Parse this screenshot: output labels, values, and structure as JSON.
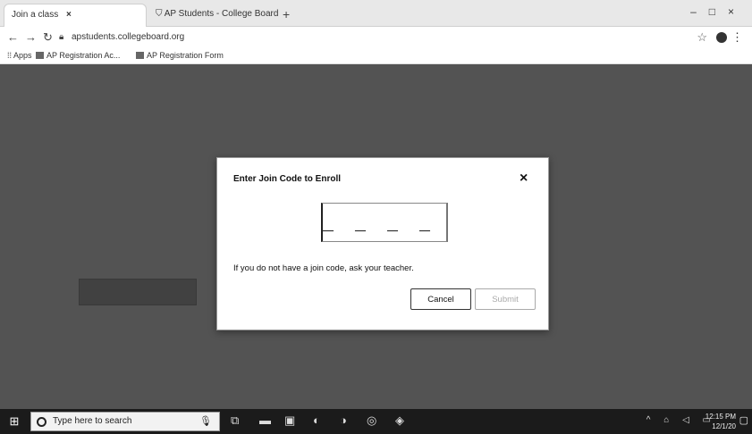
{
  "browser": {
    "tabs": [
      {
        "label": "Join a class",
        "active": true
      },
      {
        "label": "AP Students - College Board",
        "active": false
      }
    ],
    "url": "apstudents.collegeboard.org",
    "bookmarks": [
      {
        "label": "Apps"
      },
      {
        "label": "AP Registration Ac..."
      },
      {
        "label": "AP Registration Form"
      }
    ]
  },
  "modal": {
    "title": "Enter Join Code to Enroll",
    "code_placeholder": "_ _ _ _ _ _",
    "hint": "If you do not have a join code, ask your teacher.",
    "cancel_label": "Cancel",
    "submit_label": "Submit"
  },
  "taskbar": {
    "search_placeholder": "Type here to search",
    "time": "12:15 PM",
    "date": "12/1/20"
  },
  "colors": {
    "overlay": "#2d2d2d",
    "modal_bg": "#ffffff",
    "taskbar_bg": "#1b1b1b"
  },
  "icons": [
    "tab-icon",
    "close-icon",
    "back-arrow-icon",
    "forward-arrow-icon",
    "reload-icon",
    "lock-icon",
    "star-icon",
    "profile-icon",
    "menu-icon",
    "apps-icon",
    "windows-start-icon",
    "search-icon",
    "microphone-icon",
    "task-view-icon",
    "file-explorer-icon",
    "store-icon",
    "chrome-icon"
  ]
}
